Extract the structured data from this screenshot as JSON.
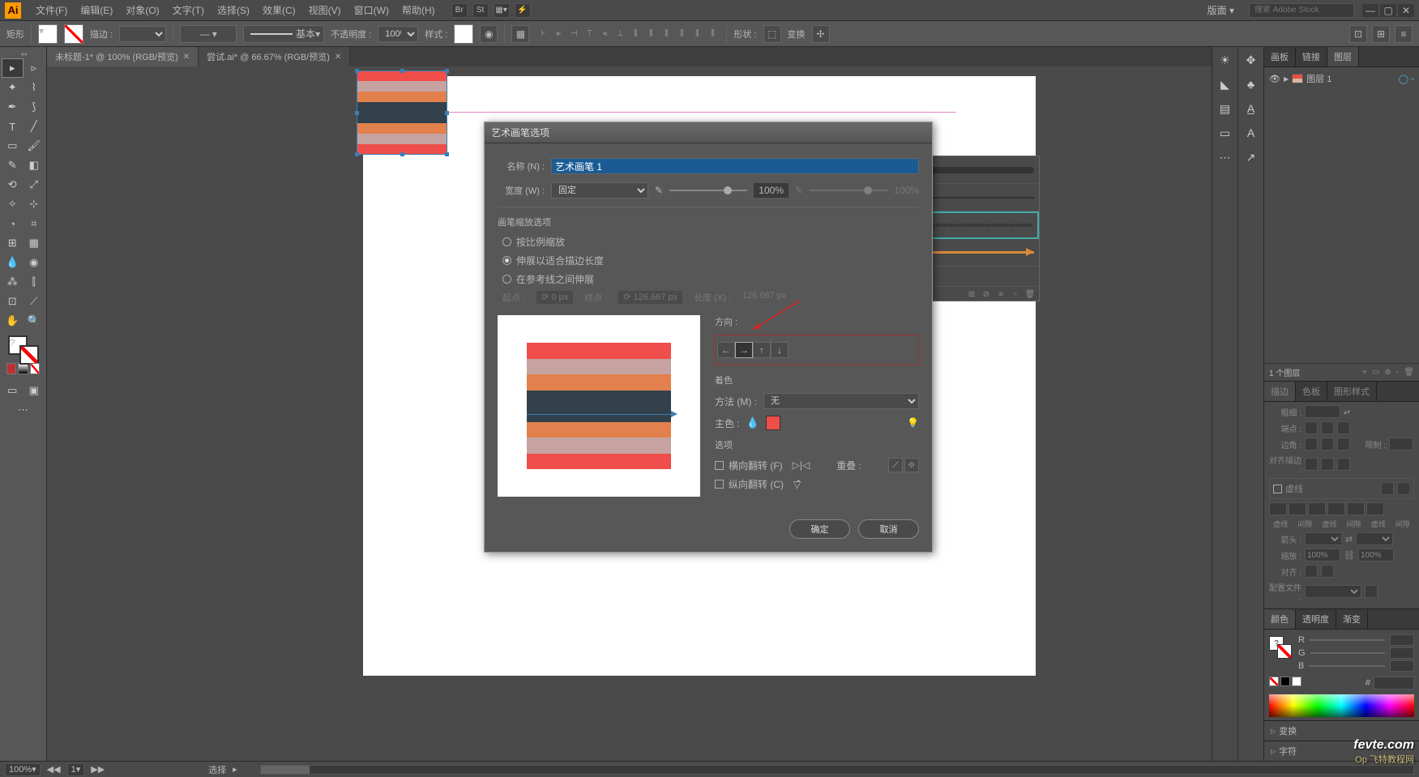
{
  "app": {
    "logo": "Ai",
    "layout_label": "版面"
  },
  "menu": [
    "文件(F)",
    "编辑(E)",
    "对象(O)",
    "文字(T)",
    "选择(S)",
    "效果(C)",
    "视图(V)",
    "窗口(W)",
    "帮助(H)"
  ],
  "menubar_icons": [
    "Br",
    "St"
  ],
  "search": {
    "placeholder": "搜索 Adobe Stock"
  },
  "controlbar": {
    "shape": "矩形",
    "stroke_label": "描边 :",
    "stroke_weight": "",
    "brush_preset": "基本",
    "opacity_label": "不透明度 :",
    "opacity_value": "100%",
    "style_label": "样式 :",
    "shape_menu": "形状 :",
    "transform": "变换"
  },
  "tabs": [
    {
      "label": "未标题-1* @ 100% (RGB/预览)",
      "active": true
    },
    {
      "label": "尝试.ai* @ 66.67% (RGB/预览)",
      "active": false
    }
  ],
  "stripes_colors": [
    "#ef4e4a",
    "#c6a3a0",
    "#e2814d",
    "#33414c",
    "#33414c",
    "#e2814d",
    "#c6a3a0",
    "#ef4e4a"
  ],
  "dialog": {
    "title": "艺术画笔选项",
    "name_label": "名称 (N) :",
    "name_value": "艺术画笔 1",
    "width_label": "宽度 (W) :",
    "width_mode": "固定",
    "width_value": "100%",
    "width_value2": "100%",
    "scale_group": "画笔缩放选项",
    "scale_opts": [
      "按比例缩放",
      "伸展以适合描边长度",
      "在参考线之间伸展"
    ],
    "scale_selected": 1,
    "start_label": "起点 :",
    "start_value": "0 px",
    "end_label": "终点 :",
    "end_value": "126.667 px",
    "length_label": "长度 (X) :",
    "length_value": "126.667 px",
    "direction_label": "方向 :",
    "colorize_label": "着色",
    "method_label": "方法 (M) :",
    "method_value": "无",
    "key_label": "主色 :",
    "options_label": "选项",
    "flip_h": "横向翻转 (F)",
    "flip_v": "纵向翻转 (C)",
    "overlap_label": "重叠 :",
    "ok": "确定",
    "cancel": "取消"
  },
  "right_strip1": [
    "☀",
    "◣",
    "▤",
    "▭",
    "⋯"
  ],
  "right_strip2": [
    "✥",
    "♣",
    "A̲",
    "A",
    "↗"
  ],
  "layers_panel": {
    "tabs": [
      "画板",
      "链接",
      "图层"
    ],
    "active_tab": 2,
    "layer_name": "图层 1",
    "footer": "1 个图层"
  },
  "stroke_panel": {
    "tabs": [
      "描边",
      "色板",
      "图形样式"
    ],
    "weight_label": "粗细 :",
    "cap_label": "端点 :",
    "corner_label": "边角 :",
    "limit_label": "限制 :",
    "align_label": "对齐描边 :",
    "dashed": "虚线",
    "dash_labels": [
      "虚线",
      "间隙",
      "虚线",
      "间隙",
      "虚线",
      "间隙"
    ],
    "arrow_label": "箭头 :",
    "scale_label": "缩放 :",
    "scale_val": "100%",
    "align2_label": "对齐 :",
    "profile_label": "配置文件 :"
  },
  "color_panel": {
    "tabs": [
      "颜色",
      "透明度",
      "渐变"
    ],
    "channels": [
      "R",
      "G",
      "B"
    ],
    "hex_marker": "#"
  },
  "accordions": [
    "变换",
    "字符"
  ],
  "statusbar": {
    "zoom": "100%",
    "page": "1",
    "tool": "选择"
  },
  "watermark": {
    "main": "fevte.com",
    "sub": "Op 飞特教程网"
  }
}
